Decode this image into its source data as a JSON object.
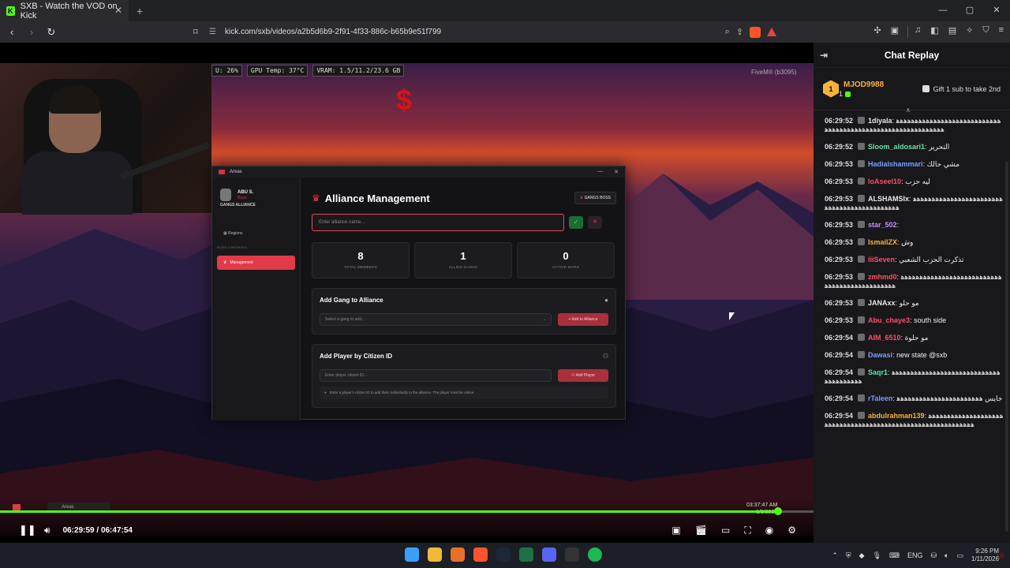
{
  "browser": {
    "tab_title": "SXB - Watch the VOD on Kick",
    "favicon_letter": "K",
    "url": "kick.com/sxb/videos/a2b5d6b9-2f91-4f33-886c-b65b9e51f799"
  },
  "stream": {
    "perf": [
      "U: 26%",
      "GPU Temp: 37°C",
      "VRAM: 1.5/11.2/23.6 GB"
    ],
    "game_build": "FiveM® (b3095)",
    "game_taskbar_label": "Areas",
    "game_time": "03:37:47 AM",
    "game_date": "1/9/2026"
  },
  "app": {
    "window_title": "Areas",
    "sidebar": {
      "user_name": "ABU S.",
      "user_role": "Boss",
      "org": "GANGS ALLIANCE",
      "item_regions": "Regions",
      "section_label": "BOSS CONTROLS",
      "item_management": "Management"
    },
    "header": {
      "title": "Alliance Management",
      "boss_button": "GANGS BOSS"
    },
    "alliance_input_placeholder": "Enter alliance name...",
    "stats": [
      {
        "value": "8",
        "label": "TOTAL MEMBERS"
      },
      {
        "value": "1",
        "label": "ALLIED GANGS"
      },
      {
        "value": "0",
        "label": "ACTIVE WARS"
      }
    ],
    "add_gang": {
      "title": "Add Gang to Alliance",
      "select_placeholder": "Select a gang to add...",
      "button": "+ Add to Alliance"
    },
    "add_player": {
      "title": "Add Player by Citizen ID",
      "input_placeholder": "Enter player citizen ID...",
      "button": "Add Player",
      "info": "Enter a player's citizen ID to add them individually to the alliance. The player must be online."
    }
  },
  "player": {
    "current_time": "06:29:59",
    "duration": "06:47:54",
    "progress": 0.956
  },
  "chat": {
    "title": "Chat Replay",
    "pinned": {
      "name": "MJOD9988",
      "count": "1",
      "rank": "1",
      "gift_text": "Gift 1 sub to take 2nd"
    },
    "messages": [
      {
        "time": "06:29:52",
        "user": "1diyala",
        "color": "#e8e8e8",
        "text": "ﻫﻫﻫﻫﻫﻫﻫﻫﻫﻫﻫﻫﻫﻫﻫﻫﻫﻫﻫﻫﻫﻫﻫﻫﻫﻫﻫﻫﻫﻫﻫﻫﻫﻫﻫﻫﻫﻫﻫﻫﻫﻫﻫﻫﻫﻫﻫﻫﻫﻫﻫﻫﻫﻫﻫﻫﻫﻫﻫﻫ"
      },
      {
        "time": "06:29:52",
        "user": "Sloom_aldosari1",
        "color": "#6be0a8",
        "text": "التحرير"
      },
      {
        "time": "06:29:53",
        "user": "Hadialshammari",
        "color": "#7b9cff",
        "text": "مشي حالك"
      },
      {
        "time": "06:29:53",
        "user": "loAseel10",
        "color": "#ff4d6a",
        "text": "ليه حزب"
      },
      {
        "time": "06:29:53",
        "user": "ALSHAMSIx",
        "color": "#e8e8e8",
        "text": "ﻫﻫﻫﻫﻫﻫﻫﻫﻫﻫﻫﻫﻫﻫﻫﻫﻫﻫﻫﻫﻫﻫﻫﻫﻫﻫﻫﻫﻫﻫﻫﻫﻫﻫﻫﻫﻫﻫﻫﻫﻫﻫﻫﻫ"
      },
      {
        "time": "06:29:53",
        "user": "star_502",
        "color": "#c58cff",
        "text": ""
      },
      {
        "time": "06:29:53",
        "user": "IsmailZX",
        "color": "#f6b23c",
        "text": "وش"
      },
      {
        "time": "06:29:53",
        "user": "iiiSeven",
        "color": "#ff4d6a",
        "text": "تذكرت الحزب الشعبي"
      },
      {
        "time": "06:29:53",
        "user": "zmhmd0",
        "color": "#ff4d6a",
        "text": "ﻫﻫﻫﻫﻫﻫﻫﻫﻫﻫﻫﻫﻫﻫﻫﻫﻫﻫﻫﻫﻫﻫﻫﻫﻫﻫﻫﻫﻫﻫﻫﻫﻫﻫﻫﻫﻫﻫﻫﻫﻫﻫﻫﻫﻫﻫ"
      },
      {
        "time": "06:29:53",
        "user": "JANAxx",
        "color": "#e8e8e8",
        "text": "مو حلو"
      },
      {
        "time": "06:29:53",
        "user": "Abu_chaye3",
        "color": "#ff4d6a",
        "text": "south side"
      },
      {
        "time": "06:29:54",
        "user": "AIM_6510",
        "color": "#ff4d6a",
        "text": "مو حلوة"
      },
      {
        "time": "06:29:54",
        "user": "Dawasi",
        "color": "#7b9cff",
        "text": "new state @sxb"
      },
      {
        "time": "06:29:54",
        "user": "Saqr1",
        "color": "#6be0a8",
        "text": "ﻫﻫﻫﻫﻫﻫﻫﻫﻫﻫﻫﻫﻫﻫﻫﻫﻫﻫﻫﻫﻫﻫﻫﻫﻫﻫﻫﻫﻫﻫﻫﻫﻫﻫﻫﻫﻫﻫﻫ"
      },
      {
        "time": "06:29:54",
        "user": "rTaleen",
        "color": "#7b9cff",
        "text": "خايس ﻫﻫﻫﻫﻫﻫﻫﻫﻫﻫﻫﻫﻫﻫﻫﻫﻫﻫﻫﻫﻫﻫﻫ"
      },
      {
        "time": "06:29:54",
        "user": "abdulrahman139",
        "color": "#f6b23c",
        "text": "ﻫﻫﻫﻫﻫﻫﻫﻫﻫﻫﻫﻫﻫﻫﻫﻫﻫﻫﻫﻫﻫﻫﻫﻫﻫﻫﻫﻫﻫﻫﻫﻫﻫﻫﻫﻫﻫﻫﻫﻫﻫﻫﻫﻫﻫﻫﻫﻫﻫﻫﻫﻫﻫﻫﻫﻫﻫﻫﻫﻫ"
      }
    ]
  },
  "taskbar": {
    "lang": "ENG",
    "time": "9:26 PM",
    "date": "1/11/2026",
    "watermark": "Vi"
  },
  "colors": {
    "kick_green": "#53fc18",
    "accent_red": "#e23a48"
  }
}
